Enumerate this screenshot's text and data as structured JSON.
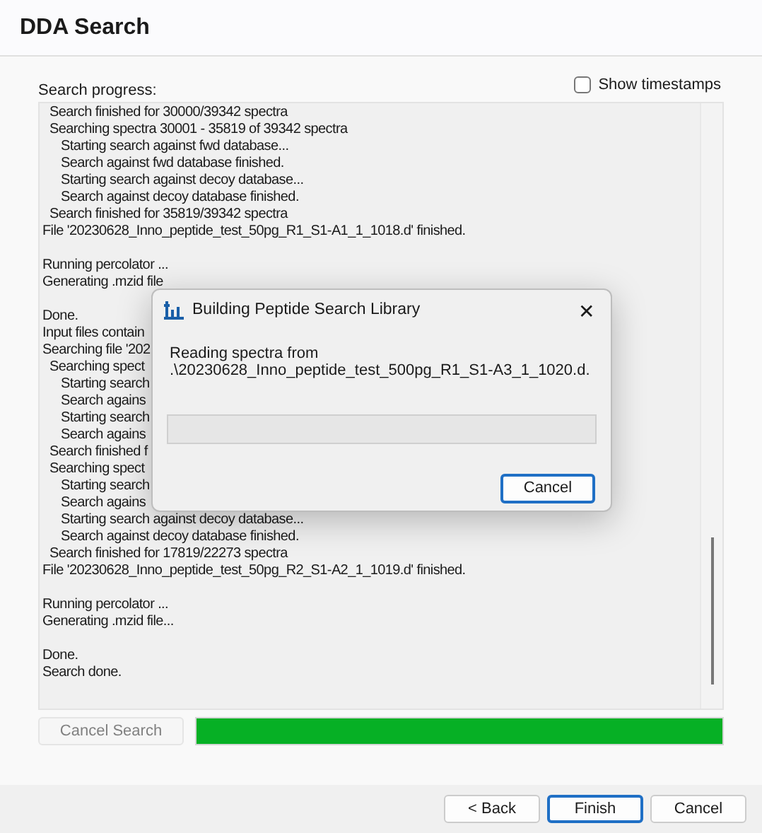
{
  "window": {
    "title": "DDA Search"
  },
  "progress_label": "Search progress:",
  "show_timestamps": {
    "label": "Show timestamps",
    "checked": false
  },
  "log": [
    {
      "kind": "step",
      "text": "Search finished for 30000/39342 spectra"
    },
    {
      "kind": "step",
      "text": "Searching spectra 30001 - 35819 of 39342 spectra"
    },
    {
      "kind": "substep",
      "text": "Starting search against fwd database..."
    },
    {
      "kind": "substep",
      "text": "Search against fwd database finished."
    },
    {
      "kind": "substep",
      "text": "Starting search against decoy database..."
    },
    {
      "kind": "substep",
      "text": "Search against decoy database finished."
    },
    {
      "kind": "step",
      "text": "Search finished for 35819/39342 spectra"
    },
    {
      "kind": "top",
      "text": "File '20230628_Inno_peptide_test_50pg_R1_S1-A1_1_1018.d' finished."
    },
    {
      "kind": "top",
      "text": "Running percolator ...",
      "blank_before": true
    },
    {
      "kind": "top",
      "text": "Generating .mzid file"
    },
    {
      "kind": "top",
      "text": "Done.",
      "blank_before": true
    },
    {
      "kind": "top",
      "text": "Input files contain"
    },
    {
      "kind": "top",
      "text": "Searching file '202"
    },
    {
      "kind": "step",
      "text": "Searching spect"
    },
    {
      "kind": "substep",
      "text": "Starting search"
    },
    {
      "kind": "substep",
      "text": "Search agains"
    },
    {
      "kind": "substep",
      "text": "Starting search"
    },
    {
      "kind": "substep",
      "text": "Search agains"
    },
    {
      "kind": "step",
      "text": "Search finished f"
    },
    {
      "kind": "step",
      "text": "Searching spect"
    },
    {
      "kind": "substep",
      "text": "Starting search"
    },
    {
      "kind": "substep",
      "text": "Search agains"
    },
    {
      "kind": "substep",
      "text": "Starting search against decoy database..."
    },
    {
      "kind": "substep",
      "text": "Search against decoy database finished."
    },
    {
      "kind": "step",
      "text": "Search finished for 17819/22273 spectra"
    },
    {
      "kind": "top",
      "text": "File '20230628_Inno_peptide_test_50pg_R2_S1-A2_1_1019.d' finished."
    },
    {
      "kind": "top",
      "text": "Running percolator ...",
      "blank_before": true
    },
    {
      "kind": "top",
      "text": "Generating .mzid file..."
    },
    {
      "kind": "top",
      "text": "Done.",
      "blank_before": true
    },
    {
      "kind": "top",
      "text": "Search done."
    }
  ],
  "cancel_search": {
    "label": "Cancel Search",
    "disabled": true
  },
  "search_progress": {
    "level": 1
  },
  "footer_buttons": [
    {
      "label": "< Back",
      "selected": false
    },
    {
      "label": "Finish",
      "selected": true
    },
    {
      "label": "Cancel",
      "selected": false
    }
  ],
  "dialog": {
    "title": "Building Peptide Search Library",
    "close": "✕",
    "message_lines": [
      "Reading spectra from",
      ".\\20230628_Inno_peptide_test_500pg_R1_S1-A3_1_1020.d."
    ],
    "progress": {
      "level": 0
    },
    "button": "Cancel"
  }
}
